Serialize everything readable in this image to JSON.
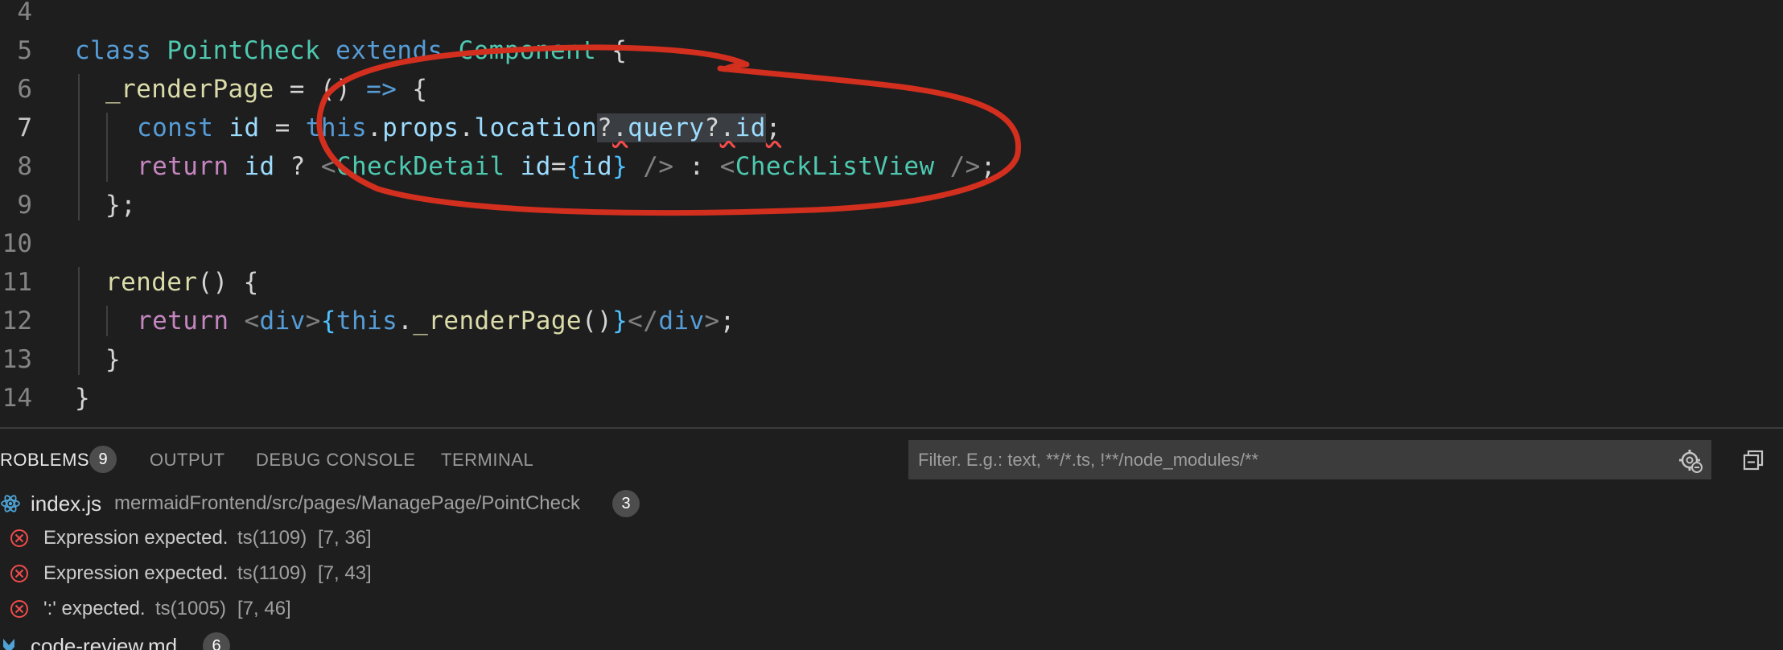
{
  "editor": {
    "lines": [
      {
        "num": "4",
        "tokens": []
      },
      {
        "num": "5",
        "tokens": [
          {
            "t": "class",
            "c": "kw"
          },
          {
            "t": " ",
            "c": "ws"
          },
          {
            "t": "PointCheck",
            "c": "cls"
          },
          {
            "t": " ",
            "c": "ws"
          },
          {
            "t": "extends",
            "c": "kw"
          },
          {
            "t": " ",
            "c": "ws"
          },
          {
            "t": "Component",
            "c": "cls"
          },
          {
            "t": " {",
            "c": "pun"
          }
        ]
      },
      {
        "num": "6",
        "tokens": [
          {
            "t": "_renderPage",
            "c": "fn"
          },
          {
            "t": " = ",
            "c": "pun"
          },
          {
            "t": "()",
            "c": "pun"
          },
          {
            "t": " ",
            "c": "ws"
          },
          {
            "t": "=>",
            "c": "kw"
          },
          {
            "t": " {",
            "c": "pun"
          }
        ]
      },
      {
        "num": "7",
        "tokens": [
          {
            "t": "const",
            "c": "kw"
          },
          {
            "t": " ",
            "c": "ws"
          },
          {
            "t": "id",
            "c": "var"
          },
          {
            "t": " = ",
            "c": "pun"
          },
          {
            "t": "this",
            "c": "kw"
          },
          {
            "t": ".",
            "c": "pun"
          },
          {
            "t": "props",
            "c": "var"
          },
          {
            "t": ".",
            "c": "pun"
          },
          {
            "t": "location",
            "c": "var"
          },
          {
            "t": "?",
            "c": "pun sel"
          },
          {
            "t": ".",
            "c": "pun sel squig"
          },
          {
            "t": "query",
            "c": "var sel"
          },
          {
            "t": "?",
            "c": "pun sel"
          },
          {
            "t": ".",
            "c": "pun sel squig"
          },
          {
            "t": "id",
            "c": "var sel"
          },
          {
            "t": ";",
            "c": "pun squig"
          }
        ]
      },
      {
        "num": "8",
        "tokens": [
          {
            "t": "return",
            "c": "kwc"
          },
          {
            "t": " ",
            "c": "ws"
          },
          {
            "t": "id",
            "c": "var"
          },
          {
            "t": " ? ",
            "c": "pun"
          },
          {
            "t": "<",
            "c": "tag"
          },
          {
            "t": "CheckDetail",
            "c": "cls"
          },
          {
            "t": " ",
            "c": "ws"
          },
          {
            "t": "id",
            "c": "var"
          },
          {
            "t": "=",
            "c": "pun"
          },
          {
            "t": "{",
            "c": "brk"
          },
          {
            "t": "id",
            "c": "var"
          },
          {
            "t": "}",
            "c": "brk"
          },
          {
            "t": " ",
            "c": "ws"
          },
          {
            "t": "/>",
            "c": "tag"
          },
          {
            "t": " : ",
            "c": "pun"
          },
          {
            "t": "<",
            "c": "tag"
          },
          {
            "t": "CheckListView",
            "c": "cls"
          },
          {
            "t": " ",
            "c": "ws"
          },
          {
            "t": "/>",
            "c": "tag"
          },
          {
            "t": ";",
            "c": "pun"
          }
        ]
      },
      {
        "num": "9",
        "tokens": [
          {
            "t": "};",
            "c": "pun"
          }
        ]
      },
      {
        "num": "10",
        "tokens": []
      },
      {
        "num": "11",
        "tokens": [
          {
            "t": "render",
            "c": "fn"
          },
          {
            "t": "()",
            "c": "pun"
          },
          {
            "t": " {",
            "c": "pun"
          }
        ]
      },
      {
        "num": "12",
        "tokens": [
          {
            "t": "return",
            "c": "kwc"
          },
          {
            "t": " ",
            "c": "ws"
          },
          {
            "t": "<",
            "c": "tag"
          },
          {
            "t": "div",
            "c": "kw"
          },
          {
            "t": ">",
            "c": "tag"
          },
          {
            "t": "{",
            "c": "brk"
          },
          {
            "t": "this",
            "c": "kw"
          },
          {
            "t": ".",
            "c": "pun"
          },
          {
            "t": "_renderPage",
            "c": "fn"
          },
          {
            "t": "()",
            "c": "pun"
          },
          {
            "t": "}",
            "c": "brk"
          },
          {
            "t": "</",
            "c": "tag"
          },
          {
            "t": "div",
            "c": "kw"
          },
          {
            "t": ">",
            "c": "tag"
          },
          {
            "t": ";",
            "c": "pun"
          }
        ]
      },
      {
        "num": "13",
        "tokens": [
          {
            "t": "}",
            "c": "pun"
          }
        ]
      },
      {
        "num": "14",
        "tokens": [
          {
            "t": "}",
            "c": "pun"
          }
        ]
      }
    ],
    "active_line": "7"
  },
  "panel": {
    "tabs": [
      {
        "label": "ROBLEMS",
        "badge": "9",
        "active": true
      },
      {
        "label": "OUTPUT"
      },
      {
        "label": "DEBUG CONSOLE"
      },
      {
        "label": "TERMINAL"
      }
    ],
    "filter_placeholder": "Filter. E.g.: text, **/*.ts, !**/node_modules/**",
    "file": {
      "name": "index.js",
      "path": "mermaidFrontend/src/pages/ManagePage/PointCheck",
      "count": "3"
    },
    "problems": [
      {
        "message": "Expression expected.",
        "code": "ts(1109)",
        "location": "[7, 36]"
      },
      {
        "message": "Expression expected.",
        "code": "ts(1109)",
        "location": "[7, 43]"
      },
      {
        "message": "':' expected.",
        "code": "ts(1005)",
        "location": "[7, 46]"
      }
    ],
    "file2": {
      "name": "code-review.md",
      "count": "6"
    }
  },
  "colors": {
    "background": "#1e1e1e",
    "annotation": "#d32f1e",
    "error": "#f14c4c"
  }
}
